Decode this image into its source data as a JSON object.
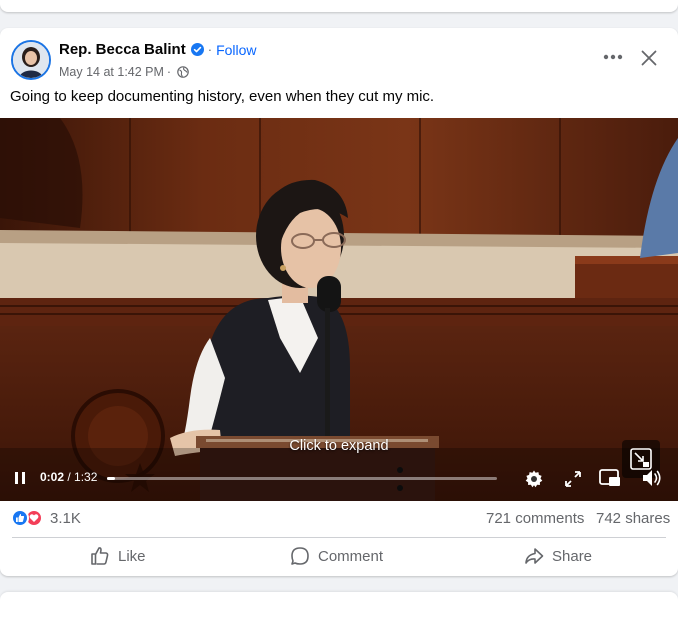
{
  "post": {
    "author": "Rep. Becca Balint",
    "follow_label": "Follow",
    "separator": "·",
    "timestamp": "May 14 at 1:42 PM",
    "audience_icon": "globe-icon",
    "text": "Going to keep documenting history, even when they cut my mic."
  },
  "video": {
    "overlay_text": "Click to expand",
    "current_time": "0:02",
    "duration": "1:32",
    "time_separator": " / ",
    "progress_fraction": 0.02
  },
  "stats": {
    "reaction_count": "3.1K",
    "comments": "721 comments",
    "shares": "742 shares"
  },
  "actions": {
    "like": "Like",
    "comment": "Comment",
    "share": "Share"
  },
  "colors": {
    "accent": "#0866ff",
    "secondary_text": "#65676b",
    "like_blue": "#1877f2",
    "love_red": "#f33e58"
  }
}
